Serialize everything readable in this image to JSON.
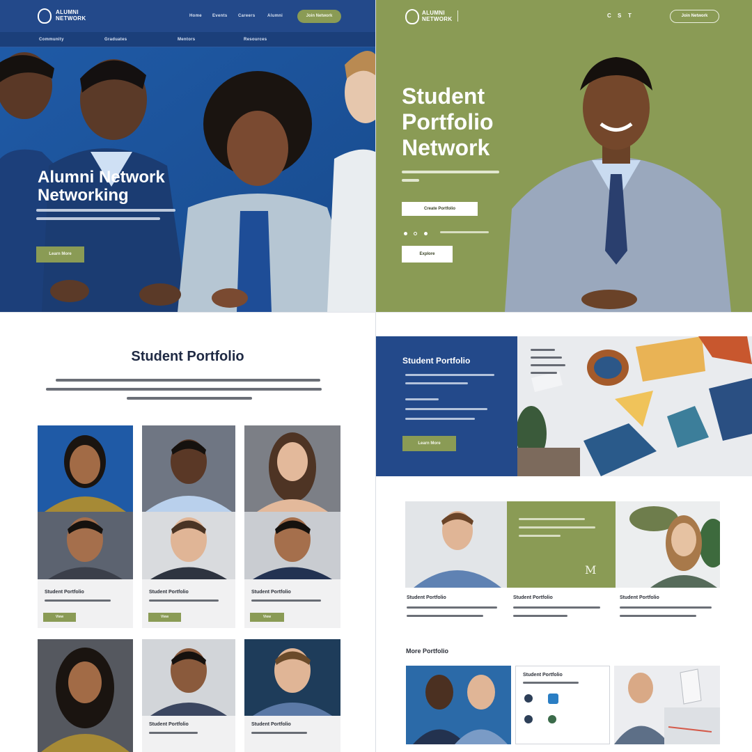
{
  "colors": {
    "navy": "#23498a",
    "olive": "#8a9b55",
    "white": "#ffffff"
  },
  "q1": {
    "logo_text": [
      "ALUMNI",
      "NETWORK"
    ],
    "nav": [
      "Home",
      "Events",
      "Careers",
      "Alumni"
    ],
    "cta": "Join Network",
    "subnav": [
      "Community",
      "Graduates",
      "Mentors",
      "Resources"
    ],
    "title_line1": "Alumni Network",
    "title_line2": "Networking",
    "button": "Learn More"
  },
  "q2": {
    "logo_text": [
      "ALUMNI",
      "NETWORK"
    ],
    "nav": [
      "C",
      "S",
      "T"
    ],
    "cta": "Join Network",
    "title": [
      "Student",
      "Portfolio",
      "Network"
    ],
    "button1": "Create Portfolio",
    "button2": "Explore"
  },
  "q3": {
    "title": "Student Portfolio",
    "cards_row2": [
      "Student Portfolio",
      "Student Portfolio",
      "Student Portfolio"
    ],
    "card_button": "View",
    "cards_row3": [
      "Student Portfolio",
      "Student Portfolio"
    ]
  },
  "q4": {
    "banner_title": "Student Portfolio",
    "banner_button": "Learn More",
    "mark": "M",
    "profiles": [
      "Student Portfolio",
      "Student Portfolio",
      "Student Portfolio"
    ],
    "section_title": "More Portfolio",
    "mini_card_title": "Student Portfolio"
  }
}
